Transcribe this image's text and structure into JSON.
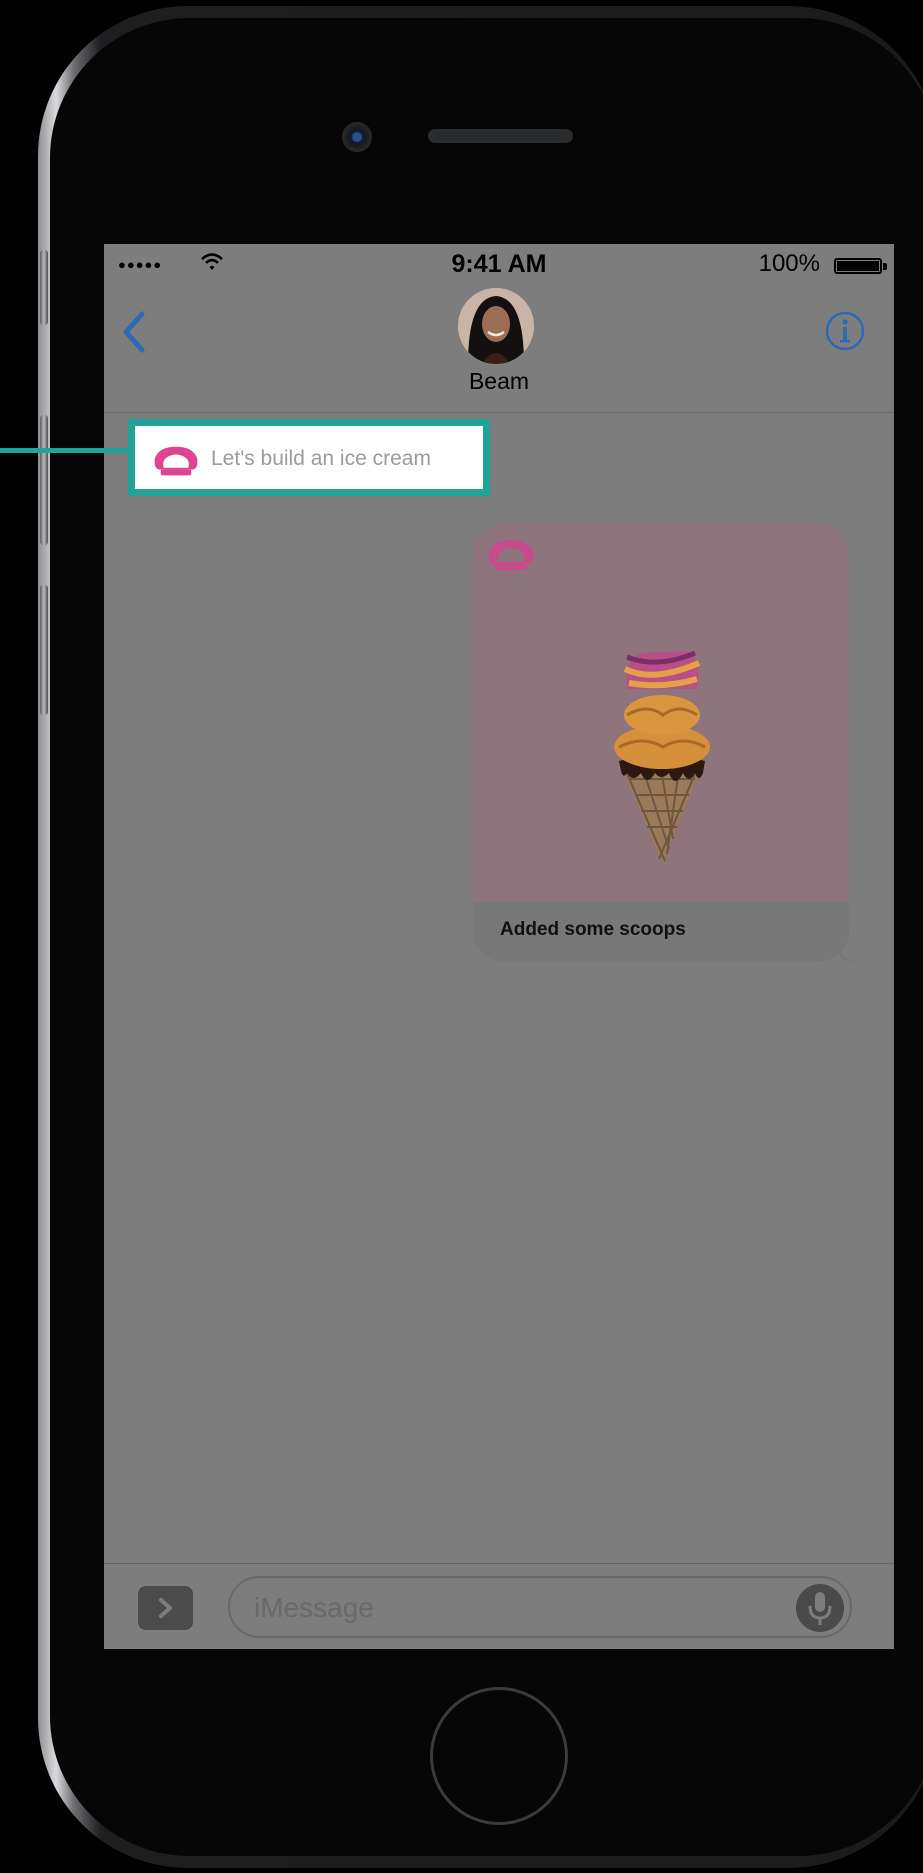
{
  "statusbar": {
    "signal": "●●●●●",
    "time": "9:41 AM",
    "battery": "100%"
  },
  "navbar": {
    "contact_name": "Beam"
  },
  "callout": {
    "text": "Let's build an ice cream"
  },
  "message": {
    "caption": "Added some scoops"
  },
  "input": {
    "placeholder": "iMessage"
  },
  "colors": {
    "highlight": "#21a397",
    "app_icon": "#e0438f",
    "ios_blue": "#2a6bb5"
  },
  "icons": [
    "back-chevron-icon",
    "info-icon",
    "wifi-icon",
    "battery-icon",
    "icecream-app-icon",
    "app-store-icon",
    "mic-icon"
  ]
}
